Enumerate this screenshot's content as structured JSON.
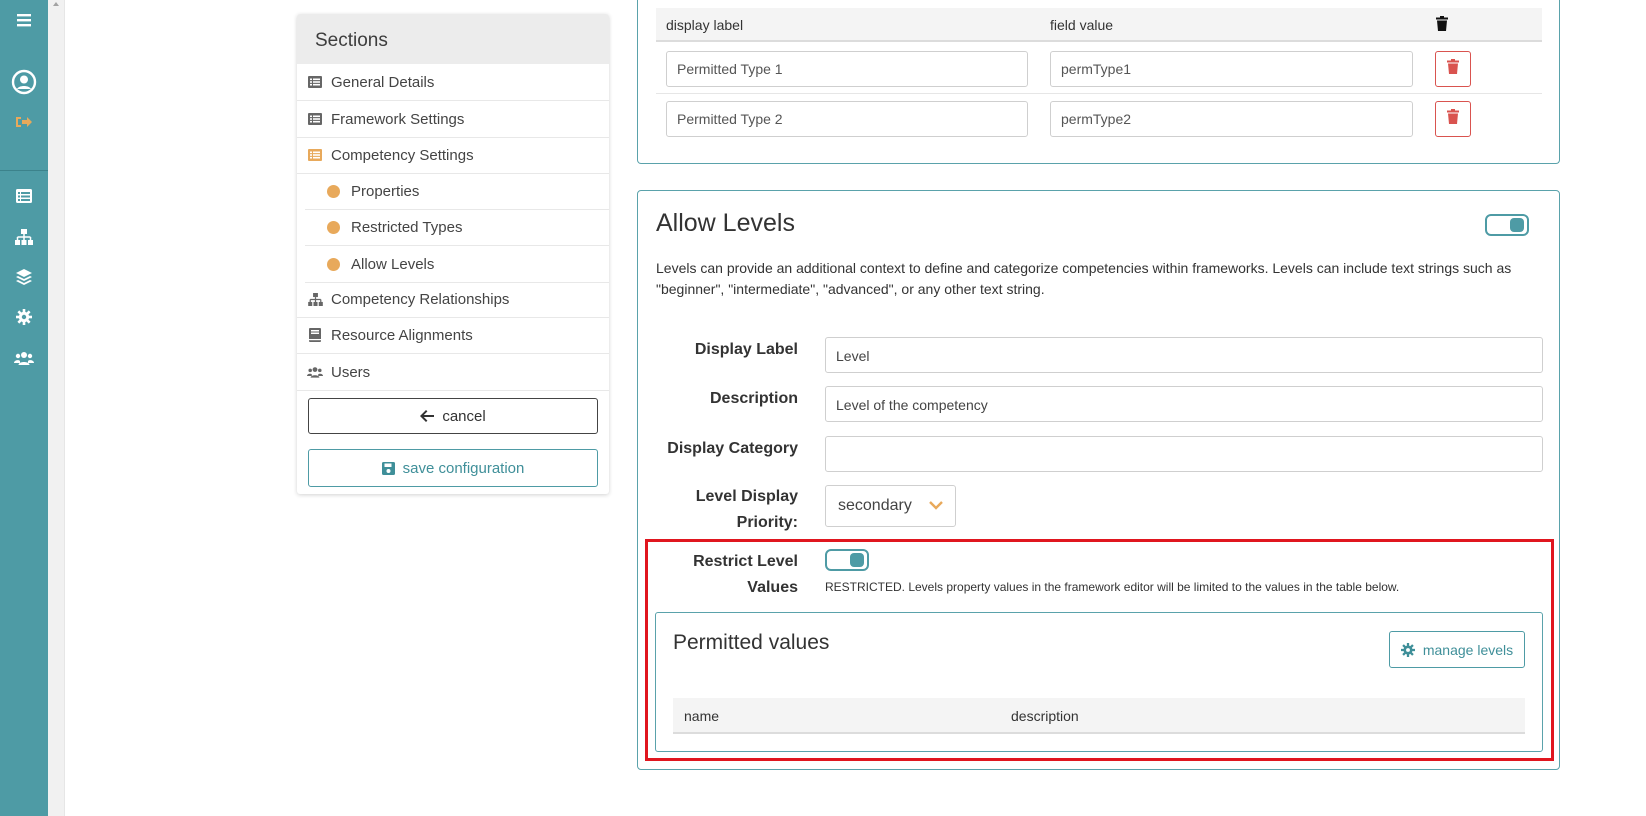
{
  "rail": {
    "icons": [
      "hamburger-menu-icon",
      "user-circle-icon",
      "sign-out-icon",
      "list-icon",
      "sitemap-icon",
      "layers-icon",
      "gear-icon",
      "users-icon"
    ]
  },
  "sections": {
    "title": "Sections",
    "items": [
      {
        "label": "General Details",
        "icon": "list-alt-icon"
      },
      {
        "label": "Framework Settings",
        "icon": "list-alt-icon"
      },
      {
        "label": "Competency Settings",
        "icon": "list-alt-icon"
      },
      {
        "label": "Properties",
        "icon": "dot-icon"
      },
      {
        "label": "Restricted Types",
        "icon": "dot-icon"
      },
      {
        "label": "Allow Levels",
        "icon": "dot-icon"
      },
      {
        "label": "Competency Relationships",
        "icon": "sitemap-icon"
      },
      {
        "label": "Resource Alignments",
        "icon": "book-icon"
      },
      {
        "label": "Users",
        "icon": "users-icon"
      }
    ],
    "cancel_label": "cancel",
    "save_label": "save configuration"
  },
  "types_table": {
    "headers": [
      "display label",
      "field value"
    ],
    "rows": [
      {
        "display_label": "Permitted Type 1",
        "field_value": "permType1"
      },
      {
        "display_label": "Permitted Type 2",
        "field_value": "permType2"
      }
    ]
  },
  "levels": {
    "title": "Allow Levels",
    "enabled": true,
    "description": "Levels can provide an additional context to define and categorize competencies within frameworks. Levels can include text strings such as \"beginner\", \"intermediate\", \"advanced\", or any other text string.",
    "fields": {
      "display_label": {
        "label": "Display Label",
        "value": "Level"
      },
      "description": {
        "label": "Description",
        "value": "Level of the competency"
      },
      "display_category": {
        "label": "Display Category",
        "value": ""
      },
      "priority": {
        "label": "Level Display Priority:",
        "value": "secondary"
      },
      "restrict": {
        "label": "Restrict Level Values",
        "enabled": true,
        "note": "RESTRICTED. Levels property values in the framework editor will be limited to the values in the table below."
      }
    },
    "permitted": {
      "title": "Permitted values",
      "manage_label": "manage levels",
      "headers": [
        "name",
        "description"
      ]
    }
  },
  "colors": {
    "rail": "#4e9ba5",
    "accent": "#e8a95b",
    "danger": "#d9534f",
    "highlight": "#e0161f"
  }
}
